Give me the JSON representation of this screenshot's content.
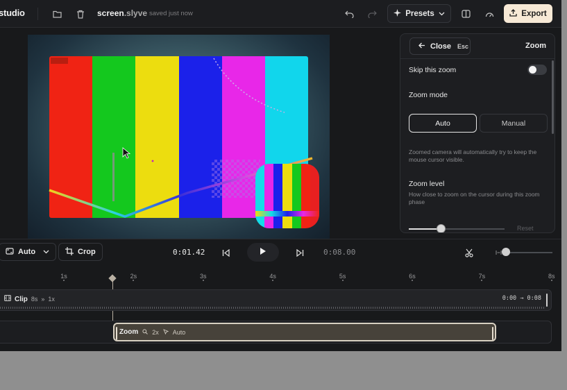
{
  "app": {
    "name": "studio"
  },
  "file": {
    "name": "screen",
    "ext": ".slyve",
    "status": "saved just now"
  },
  "toolbar": {
    "presets_label": "Presets",
    "export_label": "Export"
  },
  "panel": {
    "close_label": "Close",
    "close_shortcut": "Esc",
    "title": "Zoom",
    "skip_label": "Skip this zoom",
    "skip_enabled": false,
    "mode_label": "Zoom mode",
    "mode_options": [
      "Auto",
      "Manual"
    ],
    "mode_selected": "Auto",
    "mode_description": "Zoomed camera will automatically try to keep the mouse cursor visible.",
    "level_label": "Zoom level",
    "level_description": "How close to zoom on the cursor during this zoom phase",
    "reset_label": "Reset"
  },
  "controls": {
    "aspect_label": "Auto",
    "crop_label": "Crop",
    "current_time": "0:01.42",
    "total_time": "0:08.00"
  },
  "timeline": {
    "ticks": [
      "1s",
      "2s",
      "3s",
      "4s",
      "5s",
      "6s",
      "7s",
      "8s"
    ],
    "clip": {
      "label": "Clip",
      "duration": "8s",
      "speed": "1x",
      "range": "0:00 → 0:08"
    },
    "zoom": {
      "label": "Zoom",
      "level": "2x",
      "mode": "Auto"
    }
  },
  "colors": {
    "accent": "#f7e9d6",
    "bars": [
      "#f02314",
      "#14c81e",
      "#ecdd0f",
      "#1b21ea",
      "#e827e8",
      "#11d6ec"
    ],
    "webcam_bars": [
      "#14dce8",
      "#e827e8",
      "#1b21ea",
      "#ecdd0f",
      "#14c81e",
      "#f02314",
      "#e82020"
    ]
  }
}
